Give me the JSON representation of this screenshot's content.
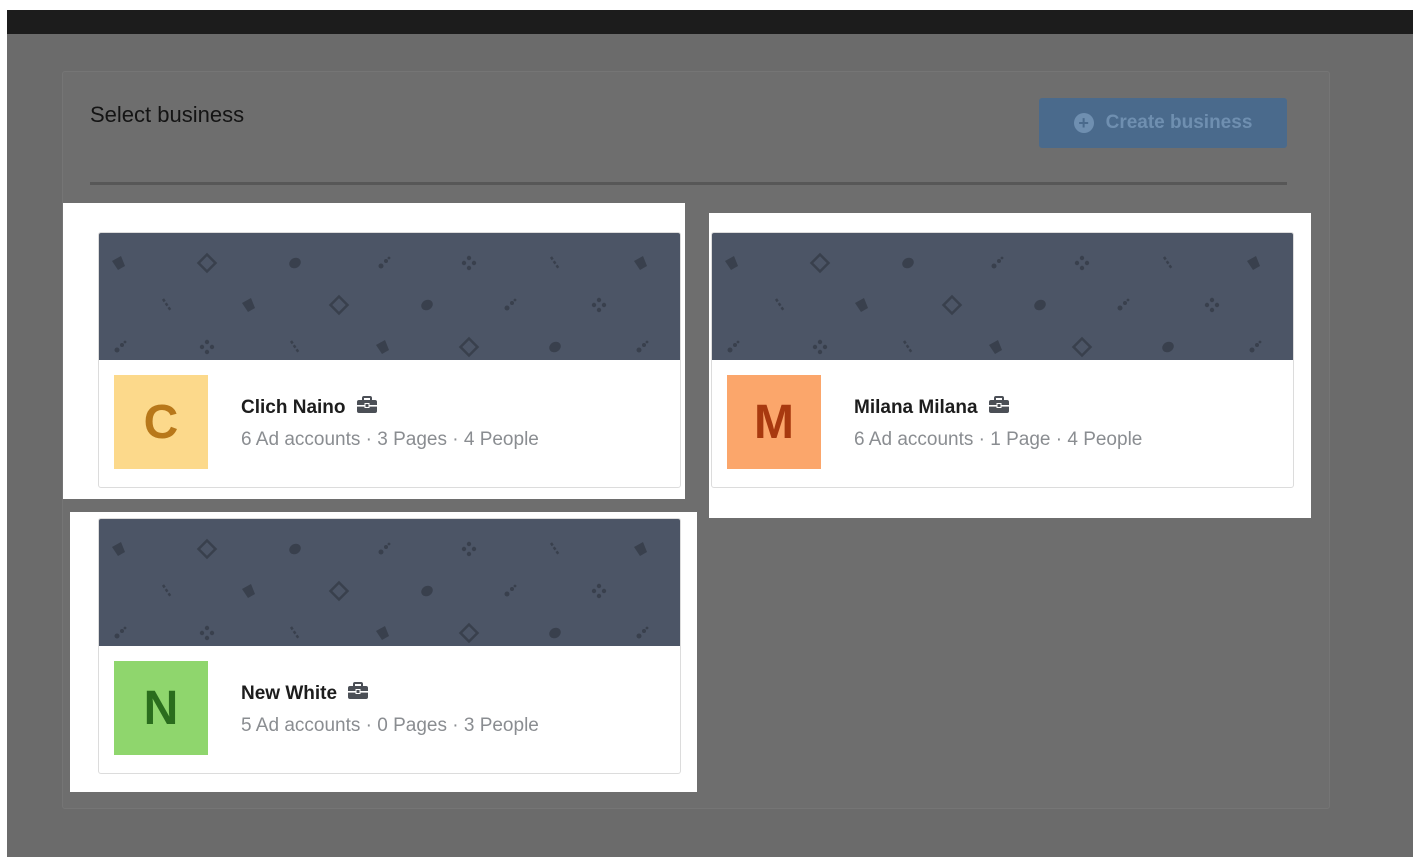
{
  "page": {
    "title": "Select business",
    "create_button": {
      "label": "Create business",
      "icon": "plus-circle-icon"
    }
  },
  "businesses": [
    {
      "name": "Clich Naino",
      "initial": "C",
      "avatar_bg": "#fcd98b",
      "avatar_fg": "#b8781a",
      "meta": "6 Ad accounts · 3 Pages · 4 People",
      "badge_icon": "briefcase-icon"
    },
    {
      "name": "Milana Milana",
      "initial": "M",
      "avatar_bg": "#fba66b",
      "avatar_fg": "#a8390f",
      "meta": "6 Ad accounts · 1 Page · 4 People",
      "badge_icon": "briefcase-icon"
    },
    {
      "name": "New White",
      "initial": "N",
      "avatar_bg": "#8fd66d",
      "avatar_fg": "#2a6d1d",
      "meta": "5 Ad accounts · 0 Pages · 3 People",
      "badge_icon": "briefcase-icon"
    }
  ],
  "colors": {
    "overlay": "#6b6b6b",
    "topbar": "#1c1c1c",
    "cover": "#4c5566",
    "cover_pattern": "#39404d",
    "highlight": "#ffffff"
  }
}
